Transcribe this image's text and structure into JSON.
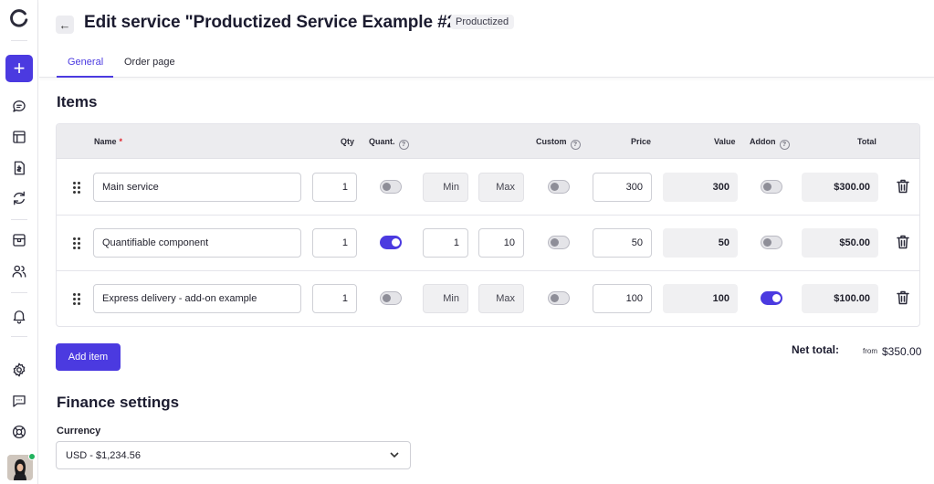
{
  "header": {
    "back_icon": "arrow-left-icon",
    "title": "Edit service \"Productized Service Example #2\"",
    "badge": "Productized",
    "tabs": [
      {
        "label": "General",
        "active": true
      },
      {
        "label": "Order page",
        "active": false
      }
    ]
  },
  "sidebar": {
    "add_label": "+",
    "icons": [
      "logo-icon",
      "chat-icon",
      "layout-icon",
      "invoice-icon",
      "refresh-icon",
      "store-icon",
      "users-icon",
      "bell-icon",
      "gear-icon",
      "message-icon",
      "help-icon",
      "avatar"
    ],
    "status_color": "#22b35e"
  },
  "items": {
    "title": "Items",
    "columns": {
      "name": "Name",
      "required_mark": "*",
      "qty": "Qty",
      "quant": "Quant.",
      "custom": "Custom",
      "price": "Price",
      "value": "Value",
      "addon": "Addon",
      "total": "Total",
      "help_glyph": "?"
    },
    "rows": [
      {
        "name": "Main service",
        "qty": "1",
        "quantifiable": false,
        "min": "Min",
        "max": "Max",
        "custom": false,
        "price": "300",
        "value": "300",
        "addon": false,
        "total": "$300.00"
      },
      {
        "name": "Quantifiable component",
        "qty": "1",
        "quantifiable": true,
        "min": "1",
        "max": "10",
        "custom": false,
        "price": "50",
        "value": "50",
        "addon": false,
        "total": "$50.00"
      },
      {
        "name": "Express delivery - add-on example",
        "qty": "1",
        "quantifiable": false,
        "min": "Min",
        "max": "Max",
        "custom": false,
        "price": "100",
        "value": "100",
        "addon": true,
        "total": "$100.00"
      }
    ],
    "add_button": "Add item",
    "net_total_label": "Net total:",
    "net_total_prefix": "from",
    "net_total_value": "$350.00"
  },
  "finance": {
    "title": "Finance settings",
    "currency_label": "Currency",
    "currency_value": "USD - $1,234.56"
  },
  "colors": {
    "accent": "#4b3ae0",
    "required": "#e0242c"
  }
}
